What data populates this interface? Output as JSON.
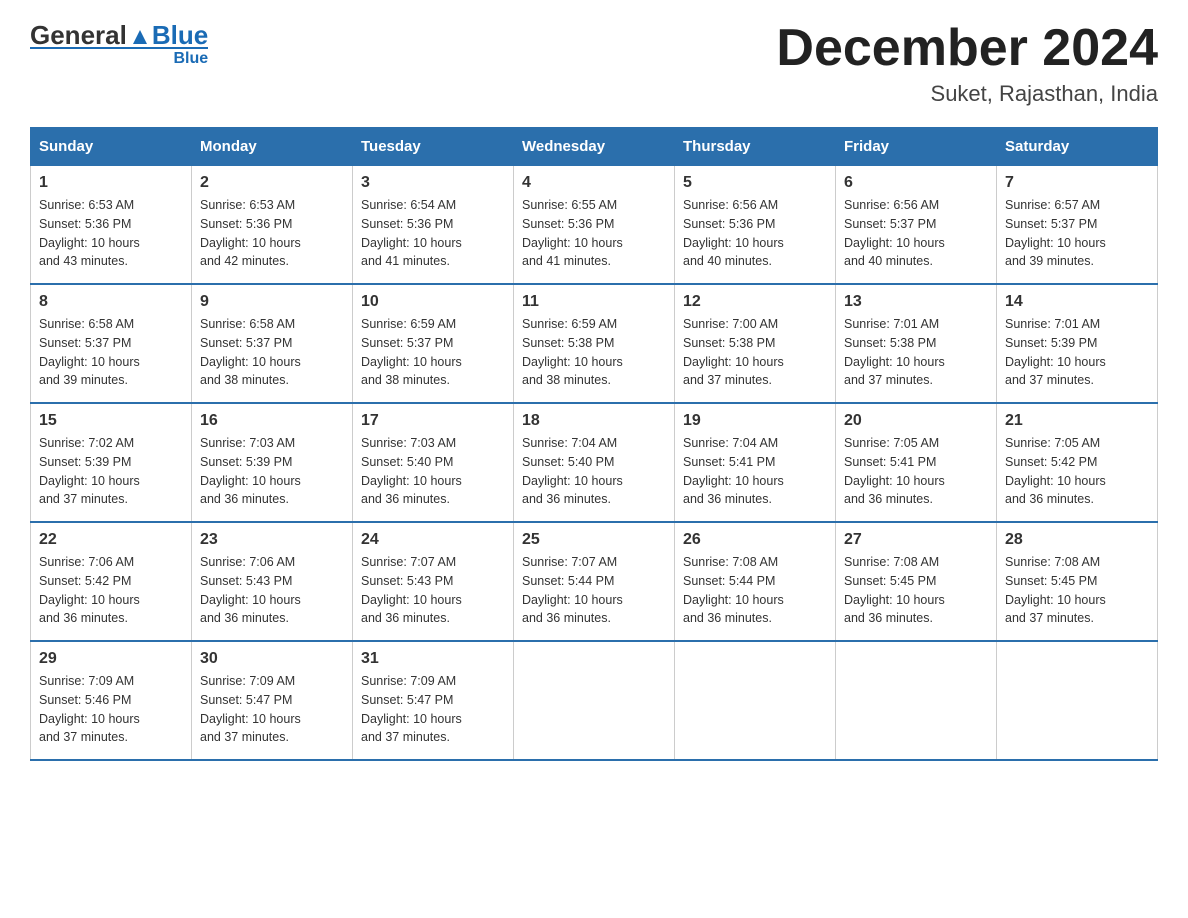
{
  "header": {
    "logo_general": "General",
    "logo_blue": "Blue",
    "month_title": "December 2024",
    "subtitle": "Suket, Rajasthan, India"
  },
  "days_of_week": [
    "Sunday",
    "Monday",
    "Tuesday",
    "Wednesday",
    "Thursday",
    "Friday",
    "Saturday"
  ],
  "weeks": [
    [
      {
        "day": "1",
        "sunrise": "6:53 AM",
        "sunset": "5:36 PM",
        "daylight": "10 hours and 43 minutes."
      },
      {
        "day": "2",
        "sunrise": "6:53 AM",
        "sunset": "5:36 PM",
        "daylight": "10 hours and 42 minutes."
      },
      {
        "day": "3",
        "sunrise": "6:54 AM",
        "sunset": "5:36 PM",
        "daylight": "10 hours and 41 minutes."
      },
      {
        "day": "4",
        "sunrise": "6:55 AM",
        "sunset": "5:36 PM",
        "daylight": "10 hours and 41 minutes."
      },
      {
        "day": "5",
        "sunrise": "6:56 AM",
        "sunset": "5:36 PM",
        "daylight": "10 hours and 40 minutes."
      },
      {
        "day": "6",
        "sunrise": "6:56 AM",
        "sunset": "5:37 PM",
        "daylight": "10 hours and 40 minutes."
      },
      {
        "day": "7",
        "sunrise": "6:57 AM",
        "sunset": "5:37 PM",
        "daylight": "10 hours and 39 minutes."
      }
    ],
    [
      {
        "day": "8",
        "sunrise": "6:58 AM",
        "sunset": "5:37 PM",
        "daylight": "10 hours and 39 minutes."
      },
      {
        "day": "9",
        "sunrise": "6:58 AM",
        "sunset": "5:37 PM",
        "daylight": "10 hours and 38 minutes."
      },
      {
        "day": "10",
        "sunrise": "6:59 AM",
        "sunset": "5:37 PM",
        "daylight": "10 hours and 38 minutes."
      },
      {
        "day": "11",
        "sunrise": "6:59 AM",
        "sunset": "5:38 PM",
        "daylight": "10 hours and 38 minutes."
      },
      {
        "day": "12",
        "sunrise": "7:00 AM",
        "sunset": "5:38 PM",
        "daylight": "10 hours and 37 minutes."
      },
      {
        "day": "13",
        "sunrise": "7:01 AM",
        "sunset": "5:38 PM",
        "daylight": "10 hours and 37 minutes."
      },
      {
        "day": "14",
        "sunrise": "7:01 AM",
        "sunset": "5:39 PM",
        "daylight": "10 hours and 37 minutes."
      }
    ],
    [
      {
        "day": "15",
        "sunrise": "7:02 AM",
        "sunset": "5:39 PM",
        "daylight": "10 hours and 37 minutes."
      },
      {
        "day": "16",
        "sunrise": "7:03 AM",
        "sunset": "5:39 PM",
        "daylight": "10 hours and 36 minutes."
      },
      {
        "day": "17",
        "sunrise": "7:03 AM",
        "sunset": "5:40 PM",
        "daylight": "10 hours and 36 minutes."
      },
      {
        "day": "18",
        "sunrise": "7:04 AM",
        "sunset": "5:40 PM",
        "daylight": "10 hours and 36 minutes."
      },
      {
        "day": "19",
        "sunrise": "7:04 AM",
        "sunset": "5:41 PM",
        "daylight": "10 hours and 36 minutes."
      },
      {
        "day": "20",
        "sunrise": "7:05 AM",
        "sunset": "5:41 PM",
        "daylight": "10 hours and 36 minutes."
      },
      {
        "day": "21",
        "sunrise": "7:05 AM",
        "sunset": "5:42 PM",
        "daylight": "10 hours and 36 minutes."
      }
    ],
    [
      {
        "day": "22",
        "sunrise": "7:06 AM",
        "sunset": "5:42 PM",
        "daylight": "10 hours and 36 minutes."
      },
      {
        "day": "23",
        "sunrise": "7:06 AM",
        "sunset": "5:43 PM",
        "daylight": "10 hours and 36 minutes."
      },
      {
        "day": "24",
        "sunrise": "7:07 AM",
        "sunset": "5:43 PM",
        "daylight": "10 hours and 36 minutes."
      },
      {
        "day": "25",
        "sunrise": "7:07 AM",
        "sunset": "5:44 PM",
        "daylight": "10 hours and 36 minutes."
      },
      {
        "day": "26",
        "sunrise": "7:08 AM",
        "sunset": "5:44 PM",
        "daylight": "10 hours and 36 minutes."
      },
      {
        "day": "27",
        "sunrise": "7:08 AM",
        "sunset": "5:45 PM",
        "daylight": "10 hours and 36 minutes."
      },
      {
        "day": "28",
        "sunrise": "7:08 AM",
        "sunset": "5:45 PM",
        "daylight": "10 hours and 37 minutes."
      }
    ],
    [
      {
        "day": "29",
        "sunrise": "7:09 AM",
        "sunset": "5:46 PM",
        "daylight": "10 hours and 37 minutes."
      },
      {
        "day": "30",
        "sunrise": "7:09 AM",
        "sunset": "5:47 PM",
        "daylight": "10 hours and 37 minutes."
      },
      {
        "day": "31",
        "sunrise": "7:09 AM",
        "sunset": "5:47 PM",
        "daylight": "10 hours and 37 minutes."
      },
      null,
      null,
      null,
      null
    ]
  ],
  "labels": {
    "sunrise": "Sunrise:",
    "sunset": "Sunset:",
    "daylight": "Daylight:"
  }
}
